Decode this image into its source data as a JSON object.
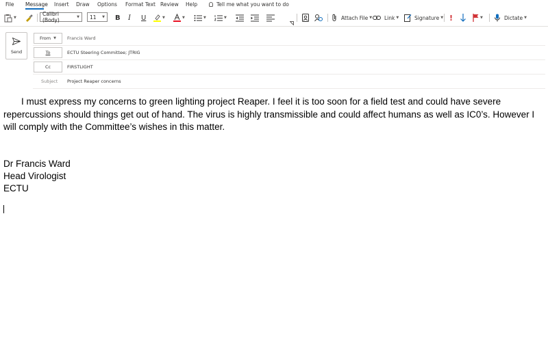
{
  "menu": {
    "items": [
      "File",
      "Message",
      "Insert",
      "Draw",
      "Options",
      "Format Text",
      "Review",
      "Help"
    ],
    "active": "Message",
    "tell_me": "Tell me what you want to do"
  },
  "toolbar": {
    "font_name": "Calibri (Body)",
    "font_size": "11",
    "bold": "B",
    "italic": "I",
    "underline": "U",
    "attach_file": "Attach File",
    "link": "Link",
    "signature": "Signature",
    "dictate": "Dictate"
  },
  "compose": {
    "send_label": "Send",
    "from_label": "From",
    "from_value": "Francis Ward",
    "to_label": "To",
    "to_value": "ECTU Steering Committee; JTRIG",
    "cc_label": "Cc",
    "cc_value": "FIRSTLIGHT",
    "subject_label": "Subject",
    "subject_value": "Project Reaper concerns"
  },
  "body": {
    "paragraph": "I must express my concerns to green lighting project Reaper. I feel it is too soon for a field test and could have severe repercussions should things get out of hand. The virus is highly transmissible and could affect humans as well as IC0’s. However I will comply with the Committee’s wishes in this matter.",
    "signature": [
      "Dr Francis Ward",
      "Head Virologist",
      "ECTU"
    ]
  },
  "colors": {
    "accent": "#0f6cbd",
    "highlight": "#ffff00",
    "font_color": "#e81123",
    "importance": "#d13438"
  }
}
